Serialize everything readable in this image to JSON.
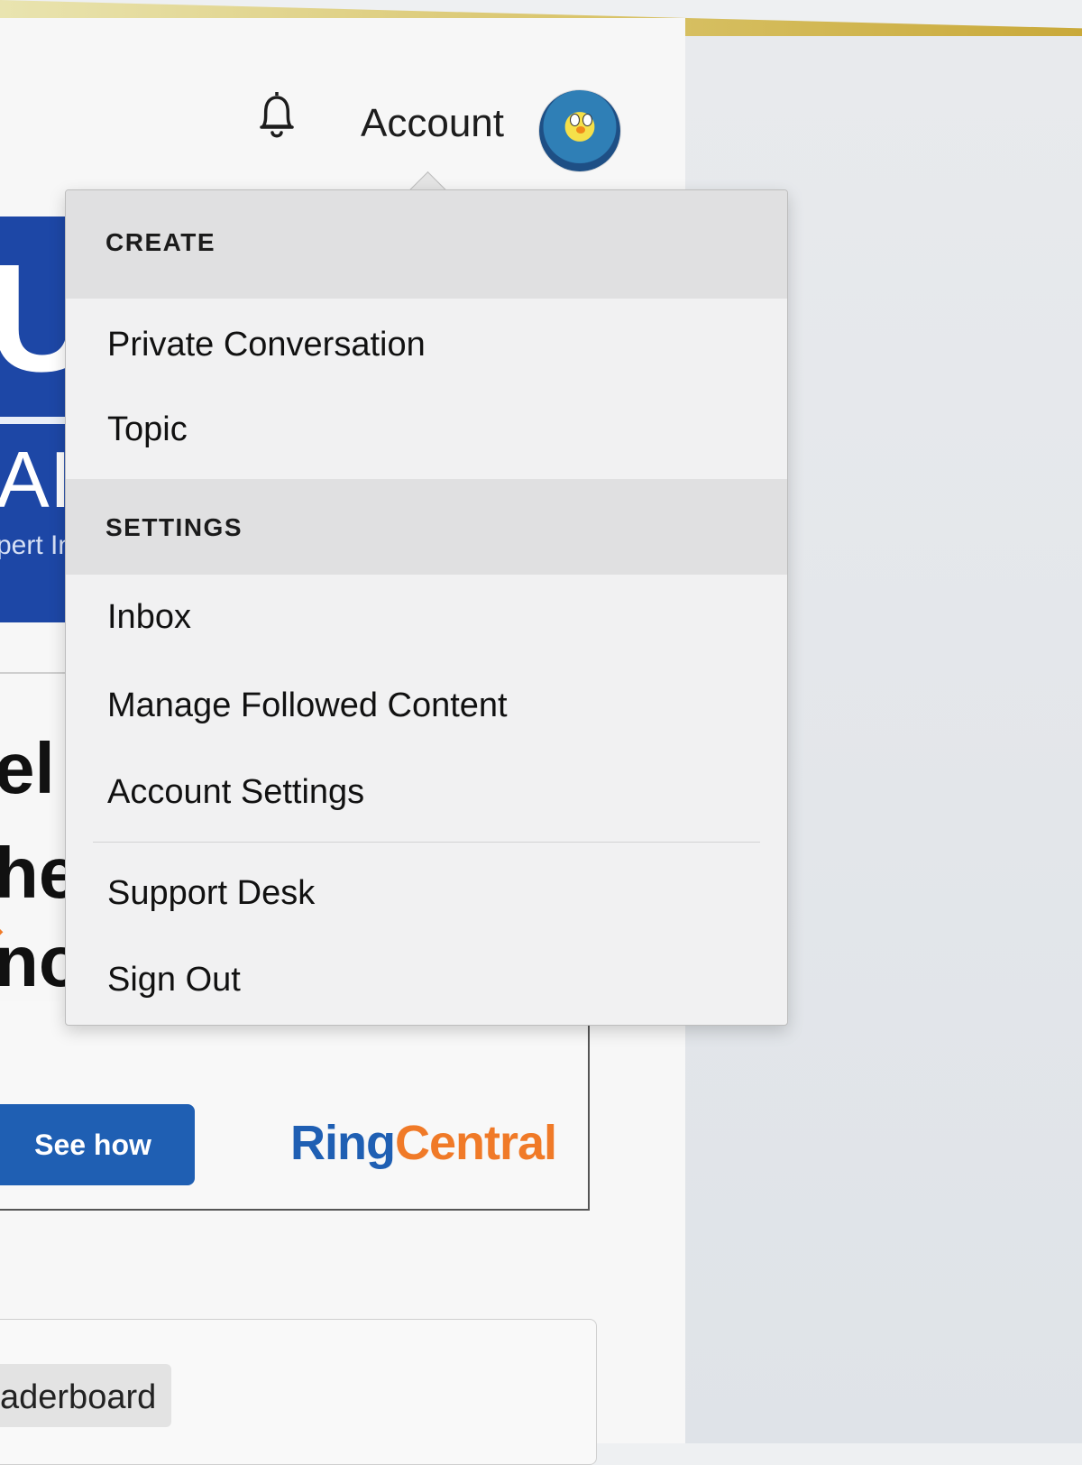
{
  "header": {
    "account_label": "Account",
    "bell_icon": "bell-icon",
    "avatar_icon": "avatar-icon"
  },
  "background": {
    "banner_letter": "U",
    "banner_text": "AI",
    "banner_subtext": "pert In",
    "fragment_1": "el",
    "fragment_2": "he",
    "fragment_3": "no",
    "see_how_label": "See how",
    "brand_ring": "Ring",
    "brand_central": "Central",
    "leaderboard_label": "aderboard"
  },
  "dropdown": {
    "create_heading": "CREATE",
    "create_items": [
      "Private Conversation",
      "Topic"
    ],
    "settings_heading": "SETTINGS",
    "settings_items": [
      "Inbox",
      "Manage Followed Content",
      "Account Settings"
    ],
    "footer_items": [
      "Support Desk",
      "Sign Out"
    ]
  },
  "colors": {
    "banner_blue": "#1d47a6",
    "button_blue": "#1f5fb3",
    "brand_orange": "#f07a28"
  }
}
